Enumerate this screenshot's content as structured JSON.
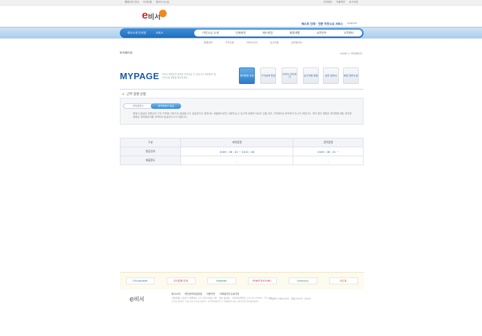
{
  "topbar": {
    "left": [
      "웹페이지 안내",
      "사이트맵",
      "찾아오시는길"
    ],
    "right": [
      "고객센터",
      "이용약관",
      "로그아웃"
    ]
  },
  "logo": {
    "e": "e",
    "text": "비서"
  },
  "header": {
    "tagline": "베스트 인재 · 전문 아웃소싱 서비스",
    "logout": "LOGOUT"
  },
  "nav": {
    "blue_items": [
      "회사소개 인사말",
      "서비스"
    ],
    "white_items": [
      "아웃소싱 소개",
      "인재파견",
      "헤드헌팅",
      "채용대행",
      "교육연수",
      "고객센터"
    ]
  },
  "subnav": [
    "회원정보",
    "구직신청",
    "이력서관리",
    "입사지원",
    "급여명세서"
  ],
  "breadcrumb": {
    "left": "마이페이지",
    "right": "HOME > 마이페이지"
  },
  "mypage": {
    "title": "MYPAGE",
    "desc": "이비서 회원님의 정보를 관리하실 수 있습니다. 회원정보 및 구직신청 현황을 확인하세요.",
    "tabs": [
      "재직증명 신청",
      "구직상태 변경",
      "이력서 관리하기",
      "입사지원 현황",
      "급여 명세서",
      "회원 정보수정"
    ]
  },
  "section": {
    "star": "★",
    "title": "근무 증명 신청"
  },
  "buttons": {
    "inactive": "재직증명서",
    "active": "경력증명서 발급"
  },
  "notice": "증명서 발급은 회원님의 근무 이력을 기준으로 발급됩니다. 발급받으신 증명서는 제출용으로만 사용하실 수 있으며 내용에 이상이 있을 경우 고객센터로 문의하여 주시기 바랍니다. 재직 중인 회원은 재직증명서를, 퇴직한 회원은 경력증명서를 선택하여 발급받으시기 바랍니다.",
  "table": {
    "headers": [
      "구분",
      "재직증명",
      "경력증명"
    ],
    "rows": [
      {
        "label": "발급일자",
        "values": [
          "2009 . 06 . 01 ~ 2010 . 06",
          "2009 . 06 . 01 ~"
        ]
      },
      {
        "label": "제출용도",
        "values": [
          "-",
          "-"
        ]
      }
    ]
  },
  "partners": [
    "Chungsuede",
    "우리은행 인재",
    "Hyundai",
    "ERNST&YOUNG",
    "Samsung",
    "에듀윌"
  ],
  "footer": {
    "logo_e": "e",
    "logo_text": "비서",
    "links": [
      "회사소개",
      "개인정보취급방침",
      "이용약관",
      "이메일무단수집거부"
    ],
    "info": "서울특별시 강남구 테헤란로 123 이비서빌딩 5층 · 대표 홍길동 · 사업자등록번호 123-45-67890 · TEL 02-1234-5678 · FAX 02-1234-5679 · COPYRIGHT ⓒ EBISEO ALL RIGHTS RESERVED",
    "right": "고객센터 1588-0000 · 평일 09:00~18:00"
  },
  "colors": {
    "brand_red": "#e2231a",
    "accent_orange": "#f08a1d",
    "nav_blue": "#1f6cbd",
    "title_blue": "#1b5aa6"
  }
}
